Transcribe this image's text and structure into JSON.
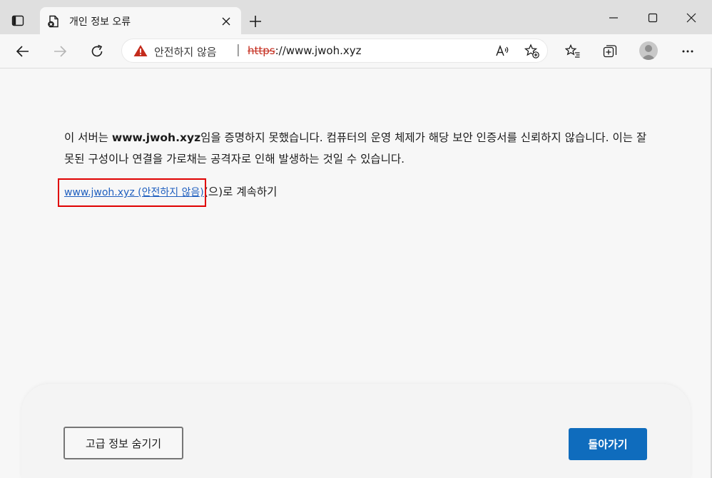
{
  "tab": {
    "title": "개인 정보 오류"
  },
  "address_bar": {
    "security_label": "안전하지 않음",
    "separator": "|",
    "url_scheme": "https",
    "url_rest": "://www.jwoh.xyz"
  },
  "error_page": {
    "message_part1": "이 서버는 ",
    "message_domain": "www.jwoh.xyz",
    "message_part2": "임을 증명하지 못했습니다. 컴퓨터의 운영 체제가 해당 보안 인증서를 신뢰하지 않습니다. 이는 잘못된 구성이나 연결을 가로채는 공격자로 인해 발생하는 것일 수 있습니다.",
    "continue_link": "www.jwoh.xyz (안전하지 않음)",
    "continue_suffix": "(으)로 계속하기",
    "advanced_button": "고급 정보 숨기기",
    "back_button": "돌아가기"
  },
  "colors": {
    "warning_red": "#c42b1c",
    "link_blue": "#1f5fbf",
    "primary_button": "#0f6cbd",
    "highlight_box": "#e00000"
  },
  "icons": {
    "tab_actions": "tab-actions-icon",
    "favicon": "error-page-icon",
    "close": "close-icon",
    "new_tab": "plus-icon",
    "minimize": "minimize-icon",
    "maximize": "maximize-icon",
    "window_close": "window-close-icon",
    "back": "back-arrow-icon",
    "forward": "forward-arrow-icon",
    "refresh": "refresh-icon",
    "warning": "warning-triangle-icon",
    "read_aloud": "read-aloud-icon",
    "add_favorite": "add-favorite-icon",
    "favorites": "favorites-icon",
    "collections": "collections-icon",
    "profile": "profile-avatar-icon",
    "more": "more-options-icon"
  }
}
